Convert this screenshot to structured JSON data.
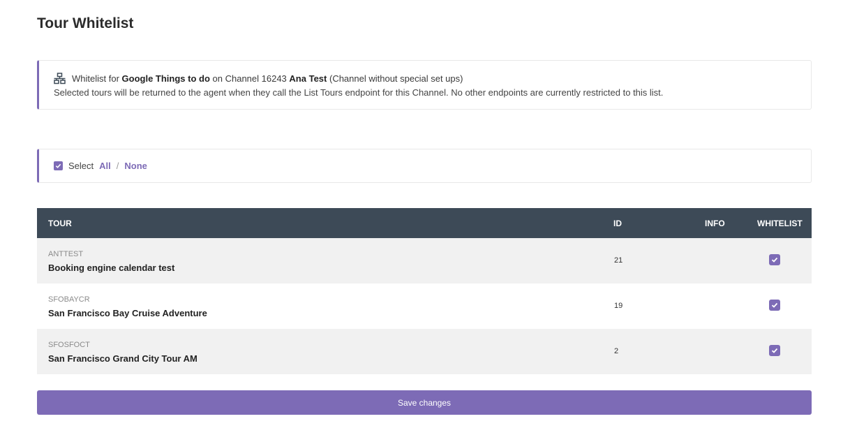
{
  "page": {
    "title": "Tour Whitelist"
  },
  "info": {
    "icon": "network-icon",
    "prefix": "Whitelist for",
    "agent": "Google Things to do",
    "on_channel": "on Channel 16243",
    "channel_name": "Ana Test",
    "channel_note": "(Channel without special set ups)",
    "description": "Selected tours will be returned to the agent when they call the List Tours endpoint for this Channel. No other endpoints are currently restricted to this list."
  },
  "select": {
    "label": "Select",
    "all": "All",
    "separator": "/",
    "none": "None",
    "checked": true
  },
  "table": {
    "headers": {
      "tour": "TOUR",
      "id": "ID",
      "info": "INFO",
      "whitelist": "WHITELIST"
    },
    "rows": [
      {
        "code": "ANTTEST",
        "name": "Booking engine calendar test",
        "id": "21",
        "whitelisted": true
      },
      {
        "code": "SFOBAYCR",
        "name": "San Francisco Bay Cruise Adventure",
        "id": "19",
        "whitelisted": true
      },
      {
        "code": "SFOSFOCT",
        "name": "San Francisco Grand City Tour AM",
        "id": "2",
        "whitelisted": true
      }
    ]
  },
  "actions": {
    "save_label": "Save changes"
  },
  "colors": {
    "accent": "#7d6bb6",
    "header_bg": "#3d4a57",
    "row_shaded": "#f1f1f1"
  }
}
